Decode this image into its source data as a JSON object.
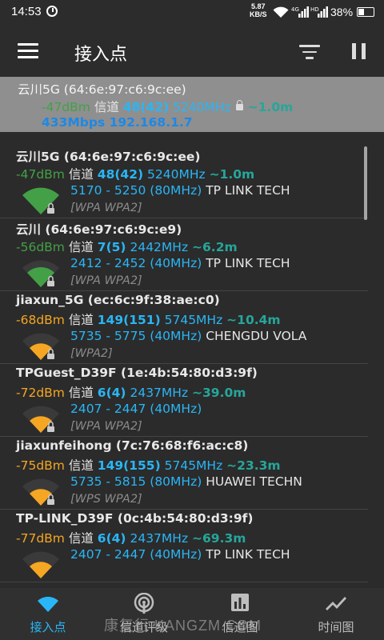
{
  "status_bar": {
    "time": "14:53",
    "net_speed_value": "5.87",
    "net_speed_unit": "KB/S",
    "signal_4g": "4G",
    "signal_hd": "HD",
    "battery": "38%"
  },
  "appbar": {
    "title": "接入点"
  },
  "connected": {
    "name": "云川5G (64:6e:97:c6:9c:ee)",
    "rssi": "-47dBm",
    "channel_label": "信道",
    "channel": "48(42)",
    "freq": "5240MHz",
    "distance": "~1.0m",
    "link": "433Mbps",
    "ip": "192.168.1.7"
  },
  "access_points": [
    {
      "name": "云川5G (64:6e:97:c6:9c:ee)",
      "rssi": "-47dBm",
      "level": "strong",
      "color": "#43a047",
      "channel_label": "信道",
      "channel": "48(42)",
      "freq": "5240MHz",
      "distance": "~1.0m",
      "range": "5170 - 5250 (80MHz)",
      "vendor": "TP LINK TECH",
      "security": "[WPA WPA2]",
      "locked": true
    },
    {
      "name": "云川 (64:6e:97:c6:9c:e9)",
      "rssi": "-56dBm",
      "level": "good",
      "color": "#43a047",
      "channel_label": "信道",
      "channel": "7(5)",
      "freq": "2442MHz",
      "distance": "~6.2m",
      "range": "2412 - 2452 (40MHz)",
      "vendor": "TP LINK TECH",
      "security": "[WPA WPA2]",
      "locked": true
    },
    {
      "name": "jiaxun_5G (ec:6c:9f:38:ae:c0)",
      "rssi": "-68dBm",
      "level": "fair",
      "color": "#f5a623",
      "channel_label": "信道",
      "channel": "149(151)",
      "freq": "5745MHz",
      "distance": "~10.4m",
      "range": "5735 - 5775 (40MHz)",
      "vendor": "CHENGDU VOLA",
      "security": "[WPA2]",
      "locked": true
    },
    {
      "name": "TPGuest_D39F (1e:4b:54:80:d3:9f)",
      "rssi": "-72dBm",
      "level": "fair",
      "color": "#f5a623",
      "channel_label": "信道",
      "channel": "6(4)",
      "freq": "2437MHz",
      "distance": "~39.0m",
      "range": "2407 - 2447 (40MHz)",
      "vendor": "",
      "security": "[WPA WPA2]",
      "locked": true
    },
    {
      "name": "jiaxunfeihong (7c:76:68:f6:ac:c8)",
      "rssi": "-75dBm",
      "level": "fair",
      "color": "#f5a623",
      "channel_label": "信道",
      "channel": "149(155)",
      "freq": "5745MHz",
      "distance": "~23.3m",
      "range": "5735 - 5815 (80MHz)",
      "vendor": "HUAWEI TECHN",
      "security": "[WPS WPA2]",
      "locked": true
    },
    {
      "name": "TP-LINK_D39F (0c:4b:54:80:d3:9f)",
      "rssi": "-77dBm",
      "level": "fair",
      "color": "#f5a623",
      "channel_label": "信道",
      "channel": "6(4)",
      "freq": "2437MHz",
      "distance": "~69.3m",
      "range": "2407 - 2447 (40MHz)",
      "vendor": "TP LINK TECH",
      "security": "",
      "locked": true
    }
  ],
  "bottom_nav": [
    {
      "label": "接入点",
      "icon": "wifi-icon",
      "active": true
    },
    {
      "label": "信道评级",
      "icon": "channel-rating-icon",
      "active": false
    },
    {
      "label": "信道图",
      "icon": "bar-chart-icon",
      "active": false
    },
    {
      "label": "时间图",
      "icon": "line-chart-icon",
      "active": false
    }
  ],
  "watermark": "康复行 KANGZM.COM",
  "colors": {
    "accent": "#29b6f6",
    "strong": "#43a047",
    "fair": "#f5a623",
    "connected_bg": "#8f8f8f",
    "background": "#2b2b2b"
  }
}
